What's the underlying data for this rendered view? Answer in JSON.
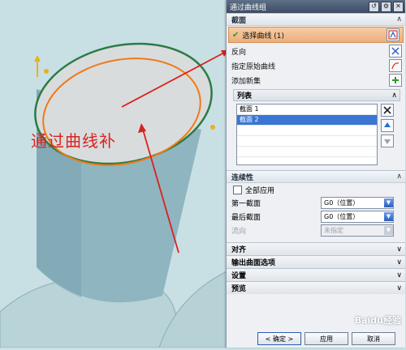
{
  "dialog": {
    "title": "通过曲线组",
    "section_section": "截面",
    "select_curve_label": "选择曲线 (1)",
    "reverse_label": "反向",
    "specify_origin_label": "指定原始曲线",
    "add_new_set_label": "添加新集",
    "list_header": "列表",
    "list_items": [
      "截面 1",
      "截面 2"
    ],
    "continuity_header": "连续性",
    "apply_all_label": "全部应用",
    "first_section_label": "第一截面",
    "first_section_value": "G0（位置）",
    "last_section_label": "最后截面",
    "last_section_value": "G0（位置）",
    "flow_label": "流向",
    "flow_value": "未指定",
    "collapsed_sections": [
      "对齐",
      "输出曲面选项",
      "设置",
      "预览"
    ],
    "ok_label": "< 确定 >",
    "apply_label": "应用",
    "cancel_label": "取消"
  },
  "canvas": {
    "annotation_text": "通过曲线补",
    "watermark": "Baidu经验"
  },
  "colors": {
    "cylinder": "#8fb5c0",
    "top_face": "#d9dcdd",
    "orange_curve": "#f07a15",
    "green_edge": "#2c7b45",
    "red_annotation": "#d9221f",
    "selection_highlight": "#ecae7c"
  }
}
